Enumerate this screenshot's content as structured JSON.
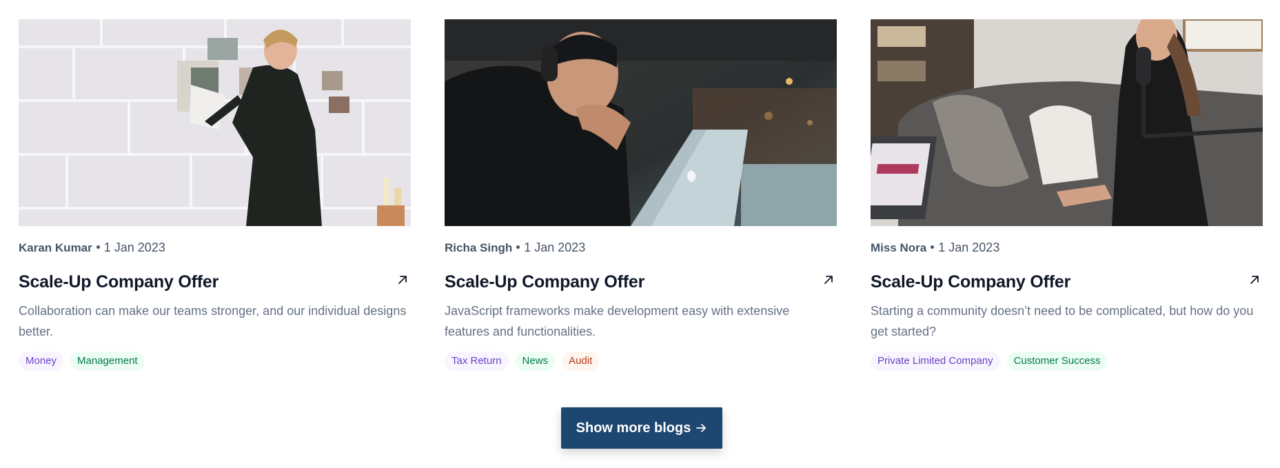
{
  "posts": [
    {
      "image": "man-arranging-photos-on-brick-wall",
      "author": "Karan Kumar",
      "date": "1 Jan 2023",
      "title": "Scale-Up Company Offer",
      "description": "Collaboration can make our teams stronger, and our individual designs better.",
      "tags": [
        {
          "label": "Money",
          "color": "purple"
        },
        {
          "label": "Management",
          "color": "green"
        }
      ]
    },
    {
      "image": "man-with-headphones-at-laptop-in-cafe",
      "author": "Richa Singh",
      "date": "1 Jan 2023",
      "title": "Scale-Up Company Offer",
      "description": "JavaScript frameworks make development easy with extensive features and functionalities.",
      "tags": [
        {
          "label": "Tax Return",
          "color": "purple"
        },
        {
          "label": "News",
          "color": "green"
        },
        {
          "label": "Audit",
          "color": "orange"
        }
      ]
    },
    {
      "image": "woman-podcasting-with-microphone-on-sofa",
      "author": "Miss Nora",
      "date": "1 Jan 2023",
      "title": "Scale-Up Company Offer",
      "description": "Starting a community doesn’t need to be complicated, but how do you get started?",
      "tags": [
        {
          "label": "Private Limited Company",
          "color": "purple"
        },
        {
          "label": "Customer Success",
          "color": "green"
        }
      ]
    }
  ],
  "show_more": {
    "label": "Show more blogs"
  },
  "colors": {
    "button": "#1d4670",
    "heading": "#101828",
    "body": "#667085",
    "meta": "#475467"
  }
}
